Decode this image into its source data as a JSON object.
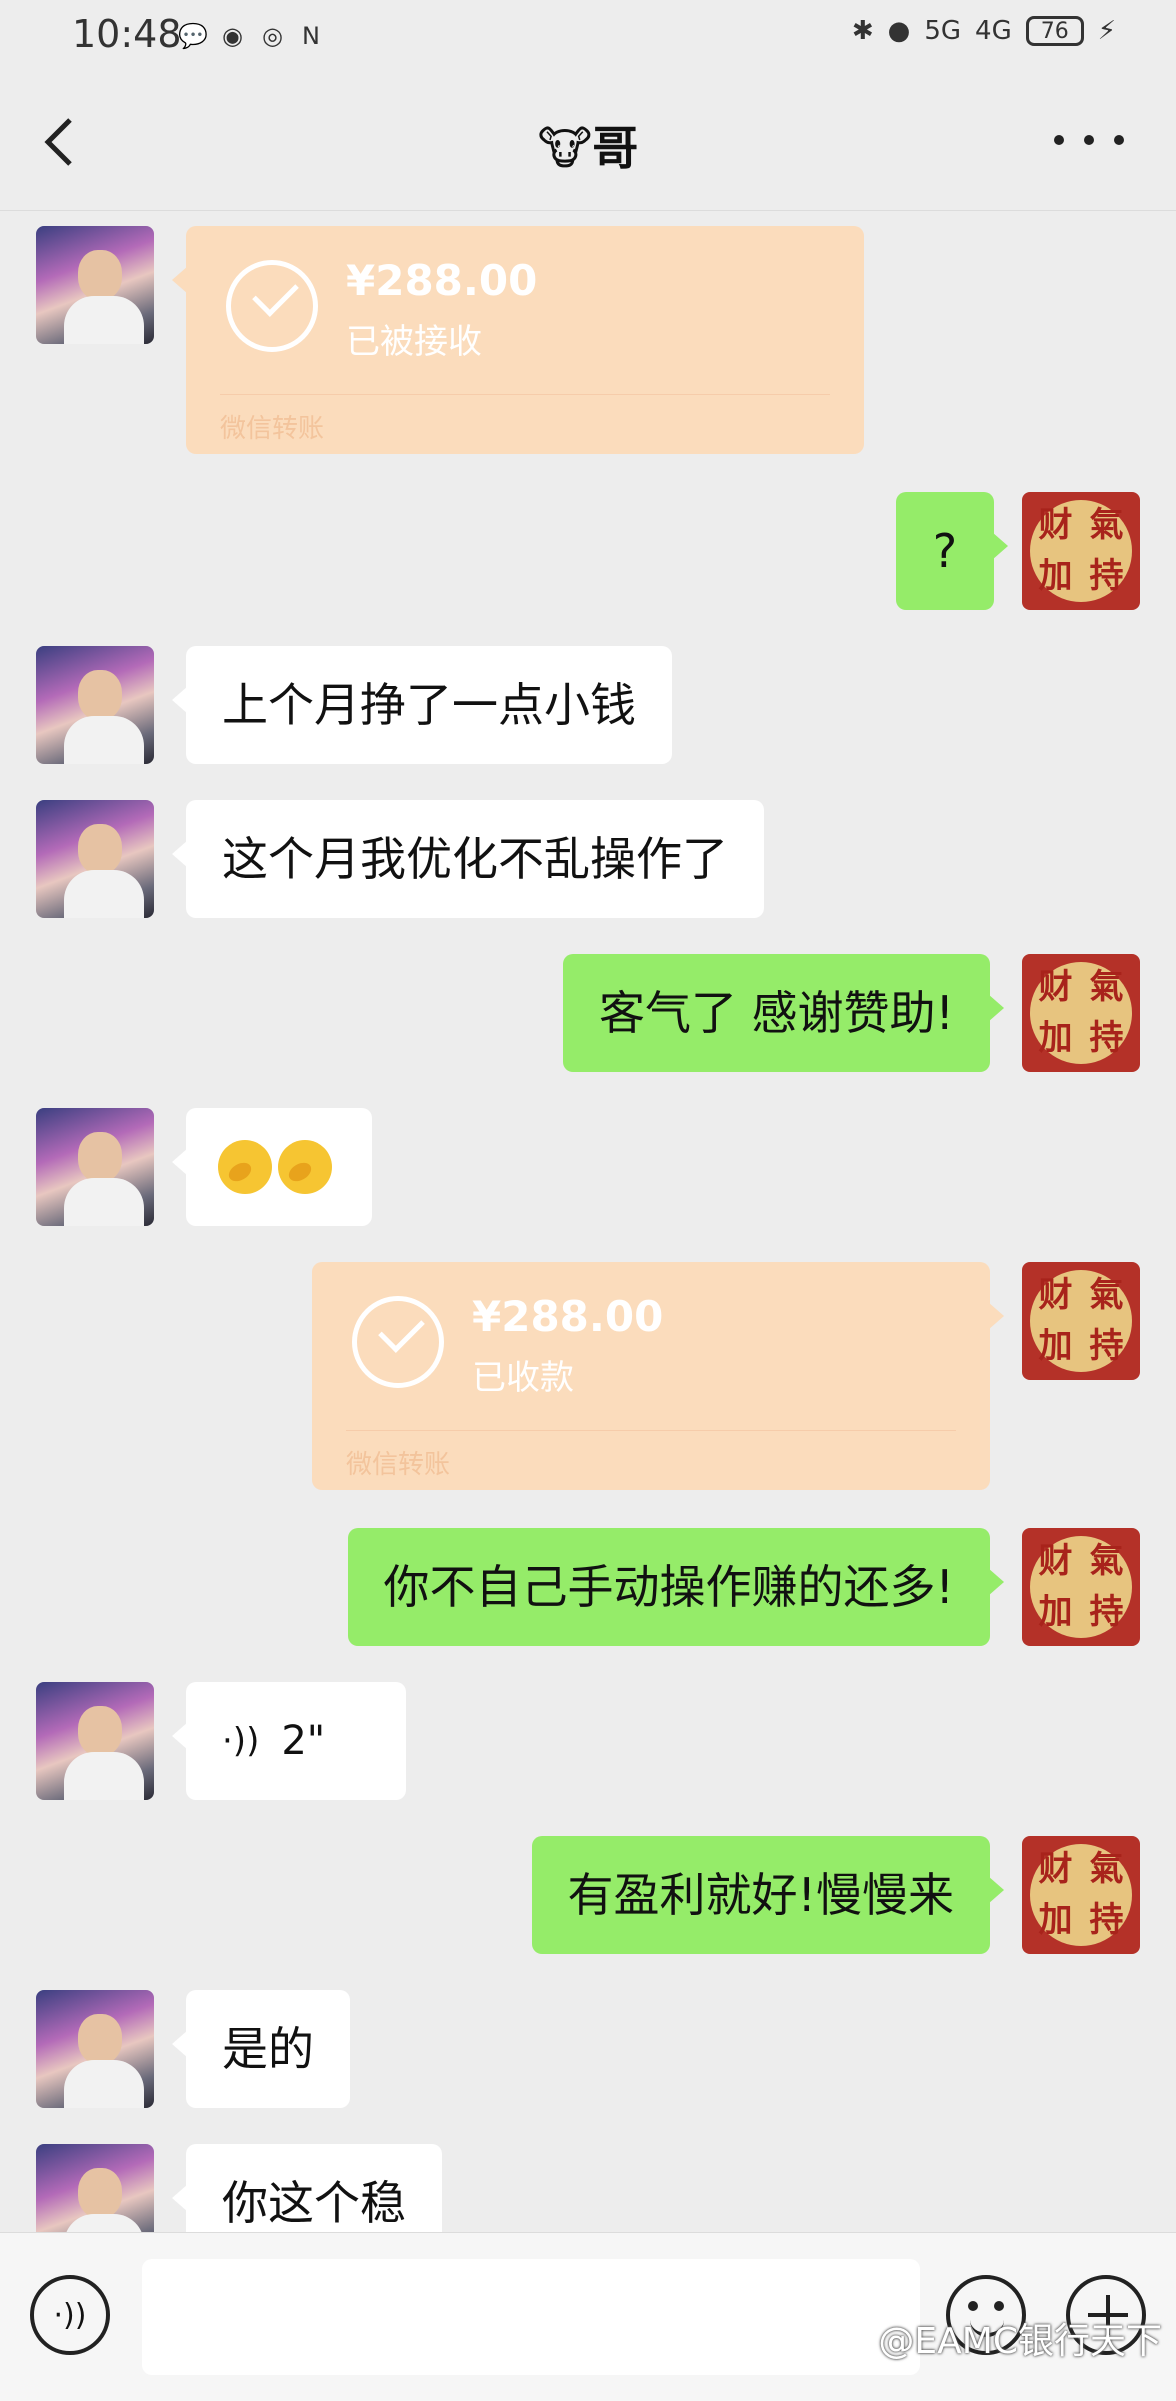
{
  "status_bar": {
    "time": "10:48",
    "network_1": "5G",
    "network_2": "4G",
    "battery": "76"
  },
  "header": {
    "title": "🐮哥"
  },
  "messages": [
    {
      "type": "transfer",
      "amount": "¥288.00",
      "status": "已被接收",
      "label": "微信转账"
    },
    {
      "type": "text",
      "text": "?"
    },
    {
      "type": "text",
      "text": "上个月挣了一点小钱"
    },
    {
      "type": "text",
      "text": "这个月我优化不乱操作了"
    },
    {
      "type": "text",
      "text": "客气了  感谢赞助!"
    },
    {
      "type": "emoji"
    },
    {
      "type": "transfer",
      "amount": "¥288.00",
      "status": "已收款",
      "label": "微信转账"
    },
    {
      "type": "text",
      "text": "你不自己手动操作赚的还多!"
    },
    {
      "type": "voice",
      "duration": "2\""
    },
    {
      "type": "text",
      "text": "有盈利就好!慢慢来"
    },
    {
      "type": "text",
      "text": "是的"
    },
    {
      "type": "text",
      "text": "你这个稳"
    }
  ],
  "self_avatar_text": [
    "财",
    "氣",
    "加",
    "持"
  ],
  "watermark": "@EAMC银行天下"
}
